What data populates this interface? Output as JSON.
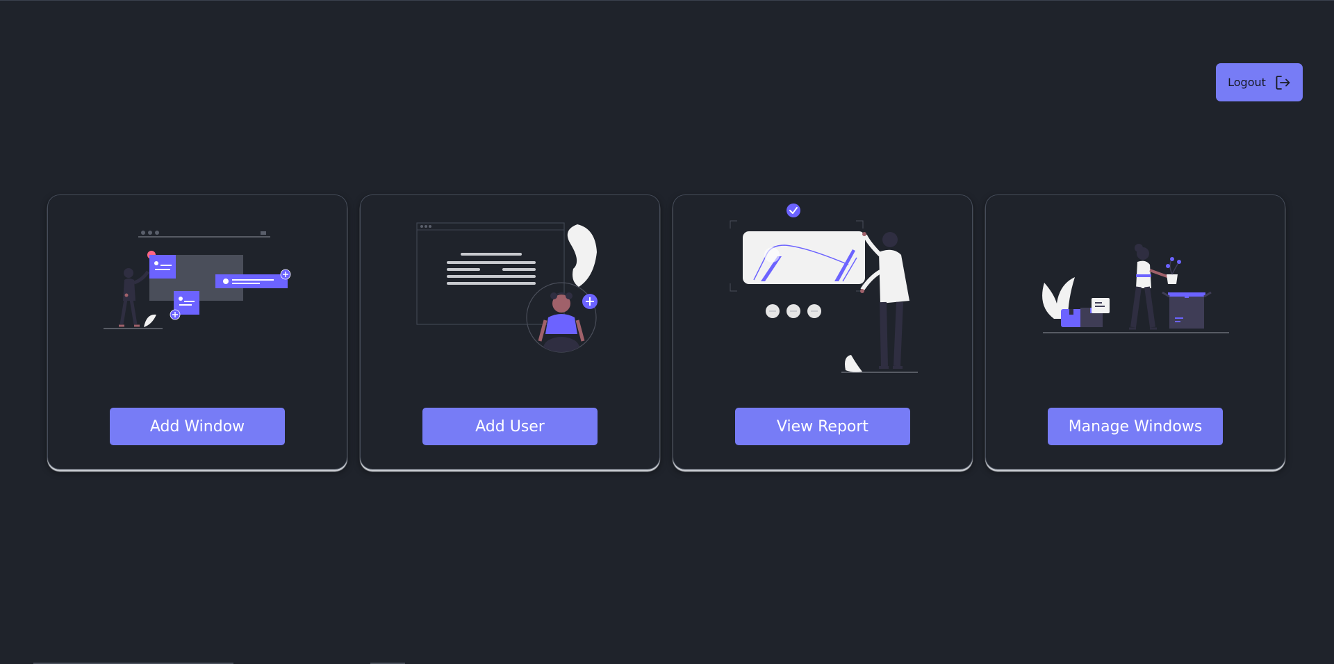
{
  "header": {
    "logout_label": "Logout",
    "logout_icon": "logout-icon"
  },
  "cards": [
    {
      "label": "Add Window",
      "illustration": "add-window-illustration"
    },
    {
      "label": "Add User",
      "illustration": "add-user-illustration"
    },
    {
      "label": "View Report",
      "illustration": "view-report-illustration"
    },
    {
      "label": "Manage Windows",
      "illustration": "manage-windows-illustration"
    }
  ],
  "colors": {
    "background": "#1f232b",
    "accent": "#777cf6",
    "illustration_purple": "#6c63ff",
    "card_border": "#454c59"
  }
}
